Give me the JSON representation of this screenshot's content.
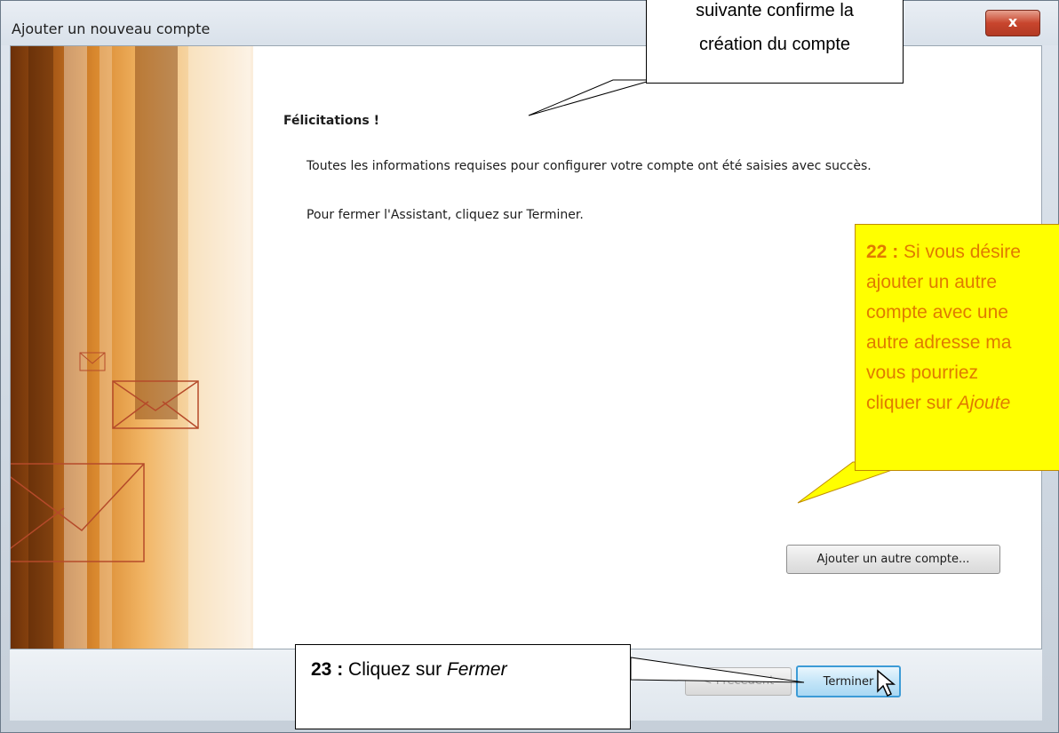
{
  "window": {
    "title": "Ajouter un nouveau compte",
    "close_label": "x"
  },
  "content": {
    "heading": "Félicitations !",
    "message1": "Toutes les informations requises pour configurer votre compte ont été saisies avec succès.",
    "message2": "Pour fermer l'Assistant, cliquez sur Terminer.",
    "add_account_button": "Ajouter un autre compte..."
  },
  "footer": {
    "prev_button": "< Précédent",
    "finish_button": "Terminer"
  },
  "annotations": {
    "top_callout": {
      "line1": "suivante confirme la",
      "line2": "création du compte"
    },
    "yellow_callout": {
      "number": "22 :",
      "line1_rest": " Si vous désire",
      "line2": "ajouter un autre",
      "line3": "compte avec une",
      "line4": "autre adresse ma",
      "line5": "vous pourriez",
      "line6_plain": "cliquer sur ",
      "line6_italic": "Ajoute"
    },
    "bottom_callout": {
      "number": "23 :",
      "text": " Cliquez sur ",
      "italic": "Fermer"
    }
  },
  "colors": {
    "callout_yellow": "#ffff00",
    "callout_text_orange": "#e07b00",
    "finish_border": "#3c9bd6"
  }
}
